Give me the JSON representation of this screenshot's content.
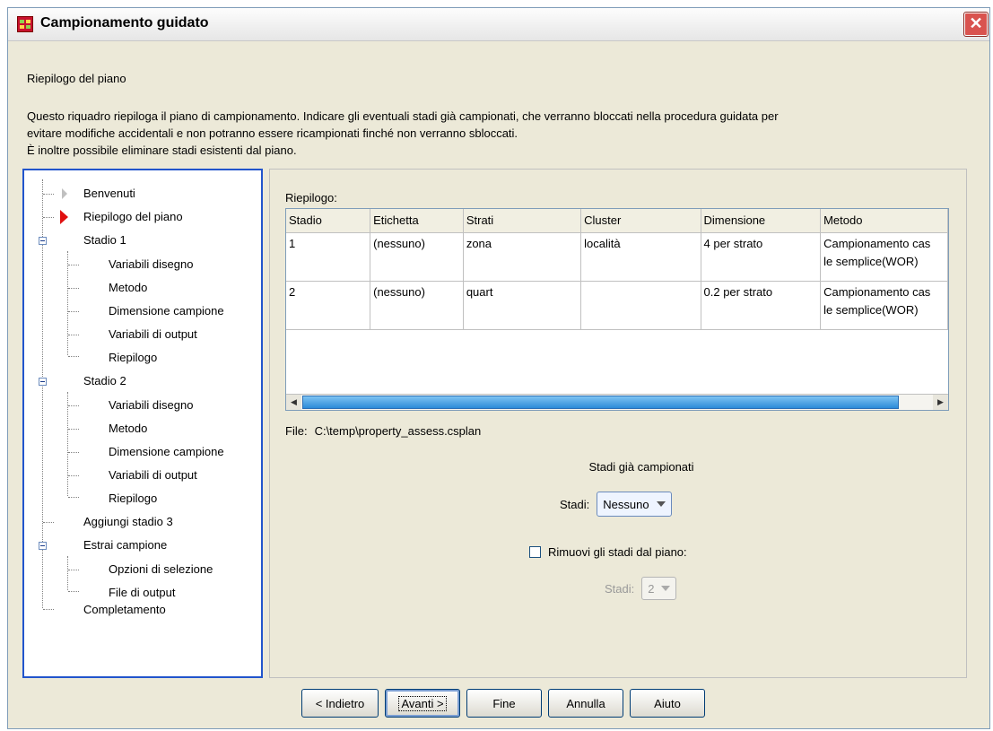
{
  "window": {
    "title": "Campionamento guidato",
    "close_glyph": "✕"
  },
  "section_title": "Riepilogo del piano",
  "description": [
    "Questo riquadro riepiloga il piano di campionamento. Indicare gli eventuali stadi già campionati, che verranno bloccati nella procedura guidata per",
    "evitare modifiche accidentali e non potranno essere ricampionati finché non verranno sbloccati.",
    "È inoltre possibile eliminare stadi esistenti dal piano."
  ],
  "tree": {
    "welcome": "Benvenuti",
    "plan_summary": "Riepilogo del piano",
    "stage1": "Stadio 1",
    "stage1_items": [
      "Variabili disegno",
      "Metodo",
      "Dimensione campione",
      "Variabili di output",
      "Riepilogo"
    ],
    "stage2": "Stadio 2",
    "stage2_items": [
      "Variabili disegno",
      "Metodo",
      "Dimensione campione",
      "Variabili di output",
      "Riepilogo"
    ],
    "add_stage3": "Aggiungi stadio 3",
    "draw_sample": "Estrai campione",
    "draw_items": [
      "Opzioni di selezione",
      "File di output"
    ],
    "completion": "Completamento"
  },
  "summary": {
    "label": "Riepilogo:",
    "columns": [
      "Stadio",
      "Etichetta",
      "Strati",
      "Cluster",
      "Dimensione",
      "Metodo"
    ],
    "rows": [
      [
        "1",
        "(nessuno)",
        "zona",
        "località",
        "4 per strato",
        "Campionamento cas",
        "le semplice(WOR)"
      ],
      [
        "2",
        "(nessuno)",
        "quart",
        "",
        "0.2 per strato",
        "Campionamento cas",
        "le semplice(WOR)"
      ]
    ],
    "scroll_left": "◀",
    "scroll_right": "▶"
  },
  "file": {
    "label": "File:",
    "path": "C:\\temp\\property_assess.csplan"
  },
  "sampled": {
    "heading": "Stadi già campionati",
    "stages_label": "Stadi:",
    "value": "Nessuno"
  },
  "remove": {
    "label": "Rimuovi gli stadi dal piano:",
    "stages_label": "Stadi:",
    "value": "2"
  },
  "buttons": {
    "back": "< Indietro",
    "next": "Avanti >",
    "finish": "Fine",
    "cancel": "Annulla",
    "help": "Aiuto"
  }
}
